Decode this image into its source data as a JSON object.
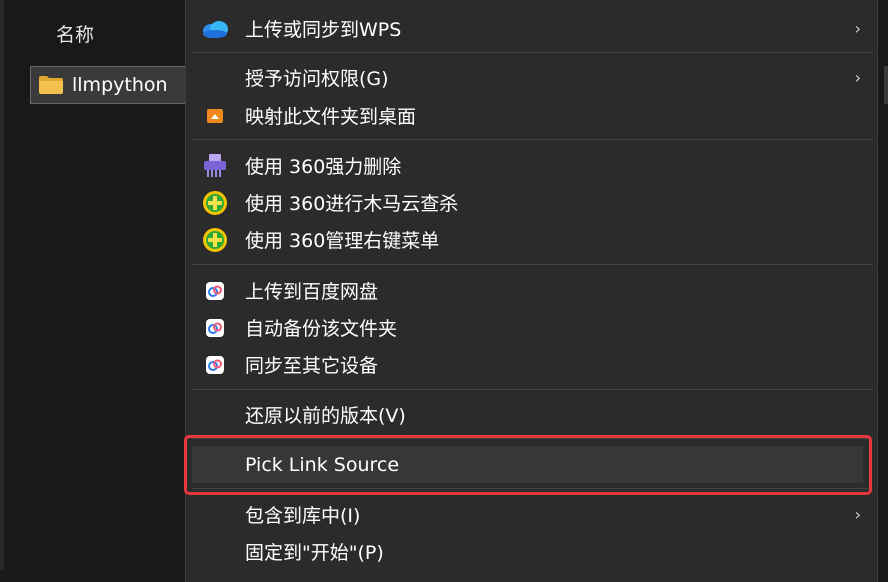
{
  "explorer": {
    "column_header": "名称",
    "selected_item": {
      "name": "llmpython",
      "icon": "folder-icon"
    }
  },
  "context_menu": {
    "items": [
      {
        "id": "upload-wps",
        "label": "上传或同步到WPS",
        "icon": "wps-cloud-icon",
        "submenu": true
      },
      {
        "id": "grant-access",
        "label": "授予访问权限(G)",
        "icon": "",
        "submenu": true
      },
      {
        "id": "map-desktop",
        "label": "映射此文件夹到桌面",
        "icon": "map-desktop-icon",
        "submenu": false
      },
      {
        "id": "force-delete",
        "label": "使用 360强力删除",
        "icon": "shredder-icon",
        "submenu": false
      },
      {
        "id": "cloud-scan",
        "label": "使用 360进行木马云查杀",
        "icon": "360-plus-icon",
        "submenu": false
      },
      {
        "id": "manage-menu",
        "label": "使用 360管理右键菜单",
        "icon": "360-plus-icon",
        "submenu": false
      },
      {
        "id": "baidu-upload",
        "label": "上传到百度网盘",
        "icon": "baidu-netdisk-icon",
        "submenu": false
      },
      {
        "id": "baidu-backup",
        "label": "自动备份该文件夹",
        "icon": "baidu-netdisk-icon",
        "submenu": false
      },
      {
        "id": "baidu-sync",
        "label": "同步至其它设备",
        "icon": "baidu-netdisk-icon",
        "submenu": false
      },
      {
        "id": "restore-version",
        "label": "还原以前的版本(V)",
        "icon": "",
        "submenu": false
      },
      {
        "id": "pick-link-source",
        "label": "Pick Link Source",
        "icon": "",
        "submenu": false,
        "highlighted": true
      },
      {
        "id": "include-library",
        "label": "包含到库中(I)",
        "icon": "",
        "submenu": true
      },
      {
        "id": "pin-start",
        "label": "固定到\"开始\"(P)",
        "icon": "",
        "submenu": false
      }
    ],
    "chevron": "›"
  },
  "colors": {
    "menu_bg": "#2b2b2b",
    "highlight_bg": "#373737",
    "annotation_red": "#e6383c",
    "folder_yellow": "#f2c14e"
  }
}
